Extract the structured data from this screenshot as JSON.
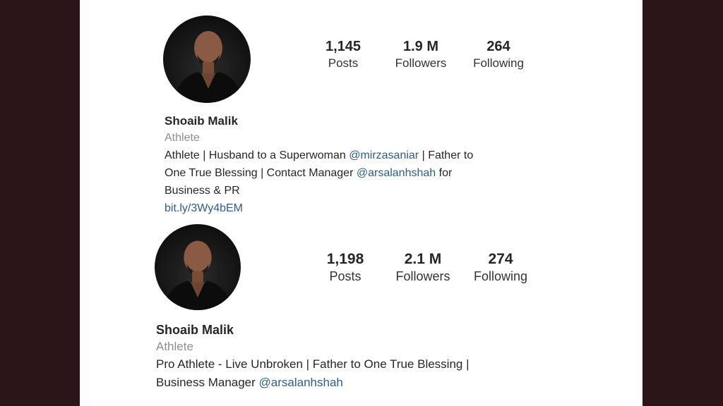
{
  "profiles": [
    {
      "stats": [
        {
          "value": "1,145",
          "label": "Posts"
        },
        {
          "value": "1.9 M",
          "label": "Followers"
        },
        {
          "value": "264",
          "label": "Following"
        }
      ],
      "name": "Shoaib Malik",
      "category": "Athlete",
      "bio": {
        "l1_a": "Athlete | Husband to a Superwoman ",
        "l1_mention": "@mirzasaniar",
        "l1_b": " | Father to",
        "l2_a": "One True Blessing | Contact Manager ",
        "l2_mention": "@arsalanhshah",
        "l2_b": " for",
        "l3": "Business & PR",
        "link": "bit.ly/3Wy4bEM"
      }
    },
    {
      "stats": [
        {
          "value": "1,198",
          "label": "Posts"
        },
        {
          "value": "2.1 M",
          "label": "Followers"
        },
        {
          "value": "274",
          "label": "Following"
        }
      ],
      "name": "Shoaib Malik",
      "category": "Athlete",
      "bio": {
        "l1": "Pro Athlete - Live Unbroken | Father to One True Blessing |",
        "l2_a": "Business Manager ",
        "l2_mention": "@arsalanhshah"
      }
    }
  ],
  "colors": {
    "background": "#2b1519",
    "mention": "#2f5d86",
    "muted": "#8e8e8e"
  },
  "icons": {
    "avatar": "profile-photo-avatar"
  }
}
